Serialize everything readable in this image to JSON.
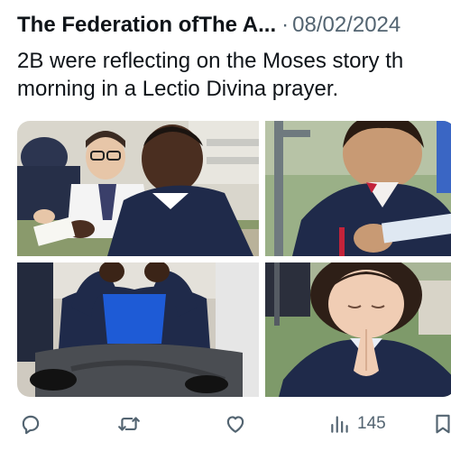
{
  "post": {
    "author": "The Federation ofThe A...",
    "separator": "·",
    "date": "08/02/2024",
    "text_lines": [
      "2B were reflecting on the Moses story th",
      "morning in a Lectio Divina prayer."
    ]
  },
  "actions": {
    "reply_icon": "reply-icon",
    "retweet_icon": "retweet-icon",
    "like_icon": "heart-icon",
    "views_icon": "views-icon",
    "views_count": "145",
    "bookmark_icon": "bookmark-icon",
    "icon_color": "#536471"
  },
  "colors": {
    "text": "#0f1419",
    "muted": "#536471",
    "uniform_navy": "#1f2a4a",
    "uniform_blue": "#1e5bd6"
  }
}
